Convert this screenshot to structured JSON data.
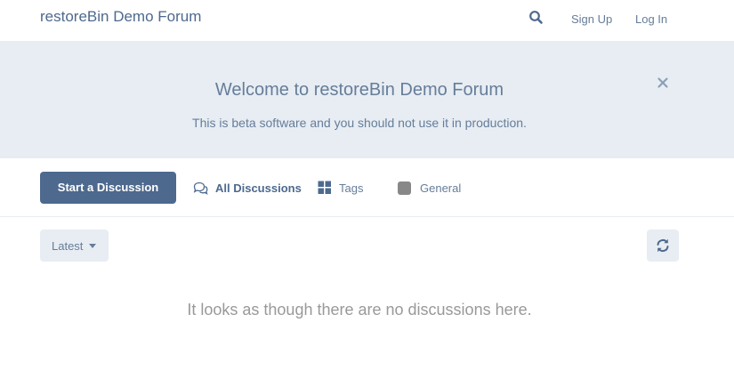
{
  "header": {
    "site_title": "restoreBin Demo Forum",
    "signup_label": "Sign Up",
    "login_label": "Log In",
    "search_icon": "search-icon"
  },
  "hero": {
    "title": "Welcome to restoreBin Demo Forum",
    "subtitle": "This is beta software and you should not use it in production.",
    "close_icon": "close-icon"
  },
  "nav": {
    "start_button": "Start a Discussion",
    "items": [
      {
        "label": "All Discussions",
        "icon": "comments-icon",
        "active": true
      },
      {
        "label": "Tags",
        "icon": "tags-grid-icon",
        "active": false
      },
      {
        "label": "General",
        "icon": "tag-color-swatch",
        "active": false
      }
    ]
  },
  "toolbar": {
    "sort_label": "Latest",
    "refresh_icon": "refresh-icon"
  },
  "main": {
    "empty_message": "It looks as though there are no discussions here."
  },
  "colors": {
    "primary": "#4d698e",
    "secondary_bg": "#e7edf3",
    "muted_text": "#667d99",
    "tag_general": "#888888"
  }
}
